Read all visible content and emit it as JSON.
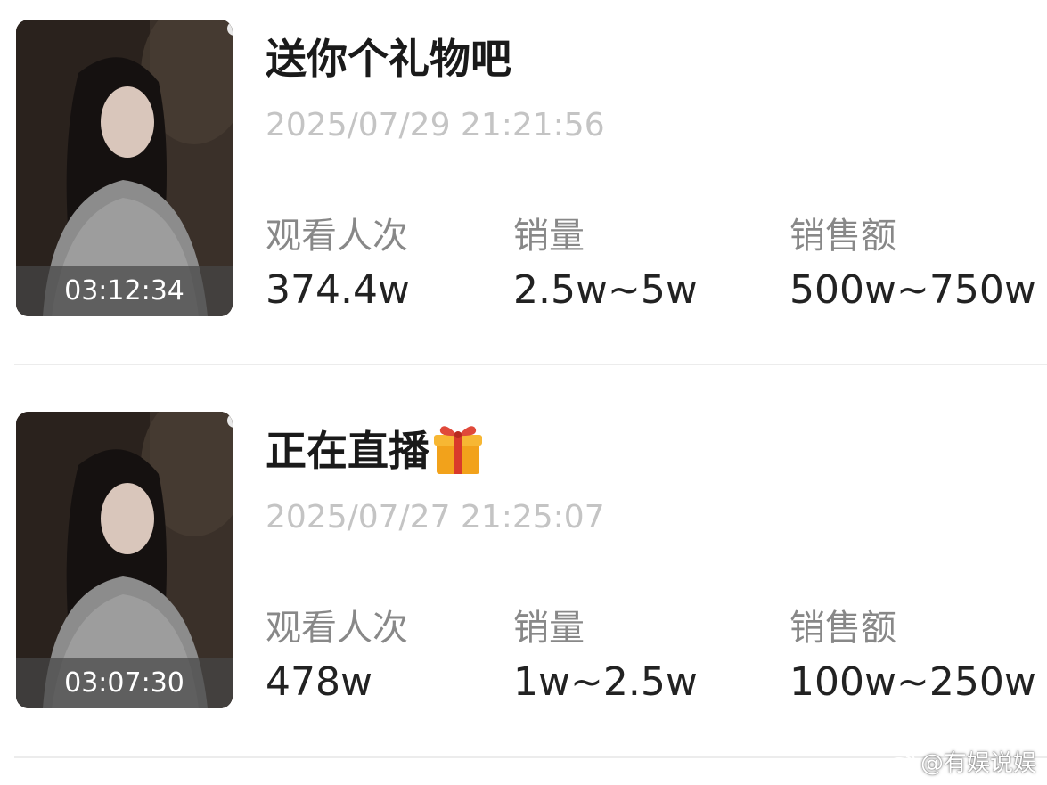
{
  "items": [
    {
      "title": "送你个礼物吧",
      "date": "2025/07/29 21:21:56",
      "duration": "03:12:34",
      "views_label": "观看人次",
      "views_value": "374.4w",
      "sales_label": "销量",
      "sales_value": "2.5w~5w",
      "amount_label": "销售额",
      "amount_value": "500w~750w"
    },
    {
      "title": "正在直播",
      "title_icon": "gift-emoji-icon",
      "date": "2025/07/27 21:25:07",
      "duration": "03:07:30",
      "views_label": "观看人次",
      "views_value": "478w",
      "sales_label": "销量",
      "sales_value": "1w~2.5w",
      "amount_label": "销售额",
      "amount_value": "100w~250w"
    }
  ],
  "watermark": "@有娱说娱",
  "colors": {
    "title": "#1a1a1a",
    "date": "#c4c4c4",
    "label": "#888888",
    "value": "#222222",
    "divider": "#ececec"
  }
}
